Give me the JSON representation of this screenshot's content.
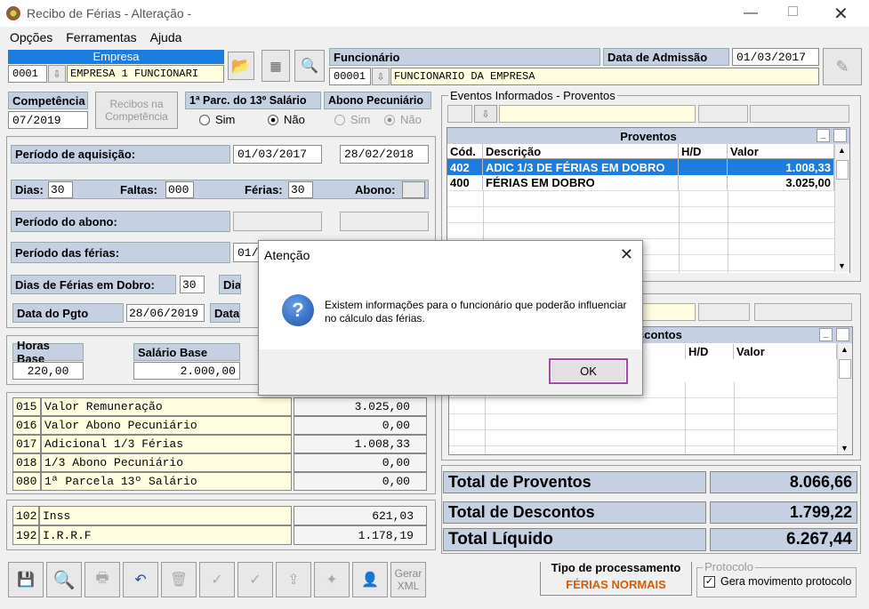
{
  "window": {
    "title": "Recibo de Férias - Alteração -"
  },
  "menu": [
    "Opções",
    "Ferramentas",
    "Ajuda"
  ],
  "empresa": {
    "label": "Empresa",
    "code": "0001",
    "name": "EMPRESA 1 FUNCIONARI"
  },
  "funcionario": {
    "label": "Funcionário",
    "code": "00001",
    "name": "FUNCIONARIO DA EMPRESA",
    "admissao_label": "Data de Admissão",
    "admissao": "01/03/2017"
  },
  "competencia": {
    "label": "Competência",
    "value": "07/2019",
    "recibos_btn": "Recibos na Competência"
  },
  "parc13": {
    "label": "1ª Parc. do 13º Salário",
    "sim": "Sim",
    "nao": "Não"
  },
  "abono": {
    "label": "Abono Pecuniário",
    "sim": "Sim",
    "nao": "Não"
  },
  "aquisicao": {
    "label": "Período de aquisição:",
    "start": "01/03/2017",
    "end": "28/02/2018"
  },
  "dias": {
    "dias_label": "Dias:",
    "dias": "30",
    "faltas_label": "Faltas:",
    "faltas": "000",
    "ferias_label": "Férias:",
    "ferias": "30",
    "abono_label": "Abono:"
  },
  "periodo_abono": {
    "label": "Período do abono:"
  },
  "periodo_ferias": {
    "label": "Período das férias:",
    "start_partial": "01/"
  },
  "dobro": {
    "label": "Dias de Férias em Dobro:",
    "value": "30",
    "next_label": "Dia"
  },
  "pgto": {
    "label": "Data do Pgto",
    "value": "28/06/2019",
    "next_label": "Data"
  },
  "horas": {
    "label": "Horas Base",
    "value": "220,00"
  },
  "salario": {
    "label": "Salário Base",
    "value": "2.000,00"
  },
  "calc": [
    {
      "code": "015",
      "desc": "Valor Remuneração",
      "value": "3.025,00"
    },
    {
      "code": "016",
      "desc": "Valor Abono Pecuniário",
      "value": "0,00"
    },
    {
      "code": "017",
      "desc": "Adicional 1/3 Férias",
      "value": "1.008,33"
    },
    {
      "code": "018",
      "desc": "1/3 Abono Pecuniário",
      "value": "0,00"
    },
    {
      "code": "080",
      "desc": "1ª Parcela 13º Salário",
      "value": "0,00"
    }
  ],
  "descontos_calc": [
    {
      "code": "102",
      "desc": "Inss",
      "value": "621,03"
    },
    {
      "code": "192",
      "desc": "I.R.R.F",
      "value": "1.178,19"
    }
  ],
  "eventos": {
    "label": "Eventos Informados - Proventos"
  },
  "proventos": {
    "title": "Proventos",
    "cols": [
      "Cód.",
      "Descrição",
      "H/D",
      "Valor"
    ],
    "rows": [
      {
        "cod": "402",
        "desc": "ADIC 1/3 DE FÉRIAS EM DOBRO",
        "hd": "",
        "valor": "1.008,33"
      },
      {
        "cod": "400",
        "desc": "FÉRIAS EM DOBRO",
        "hd": "",
        "valor": "3.025,00"
      }
    ]
  },
  "descontos": {
    "title_partial": "scontos",
    "cols": [
      "H/D",
      "Valor"
    ]
  },
  "totais": {
    "proventos_label": "Total de Proventos",
    "proventos": "8.066,66",
    "descontos_label": "Total de Descontos",
    "descontos": "1.799,22",
    "liquido_label": "Total Líquido",
    "liquido": "6.267,44"
  },
  "toolbar": {
    "xml_label": "Gerar XML"
  },
  "tipo": {
    "label": "Tipo de processamento",
    "value": "FÉRIAS NORMAIS"
  },
  "protocolo": {
    "label": "Protocolo",
    "check_label": "Gera movimento protocolo"
  },
  "dialog": {
    "title": "Atenção",
    "message": "Existem informações para o funcionário que poderão influenciar no cálculo das férias.",
    "ok": "OK"
  }
}
